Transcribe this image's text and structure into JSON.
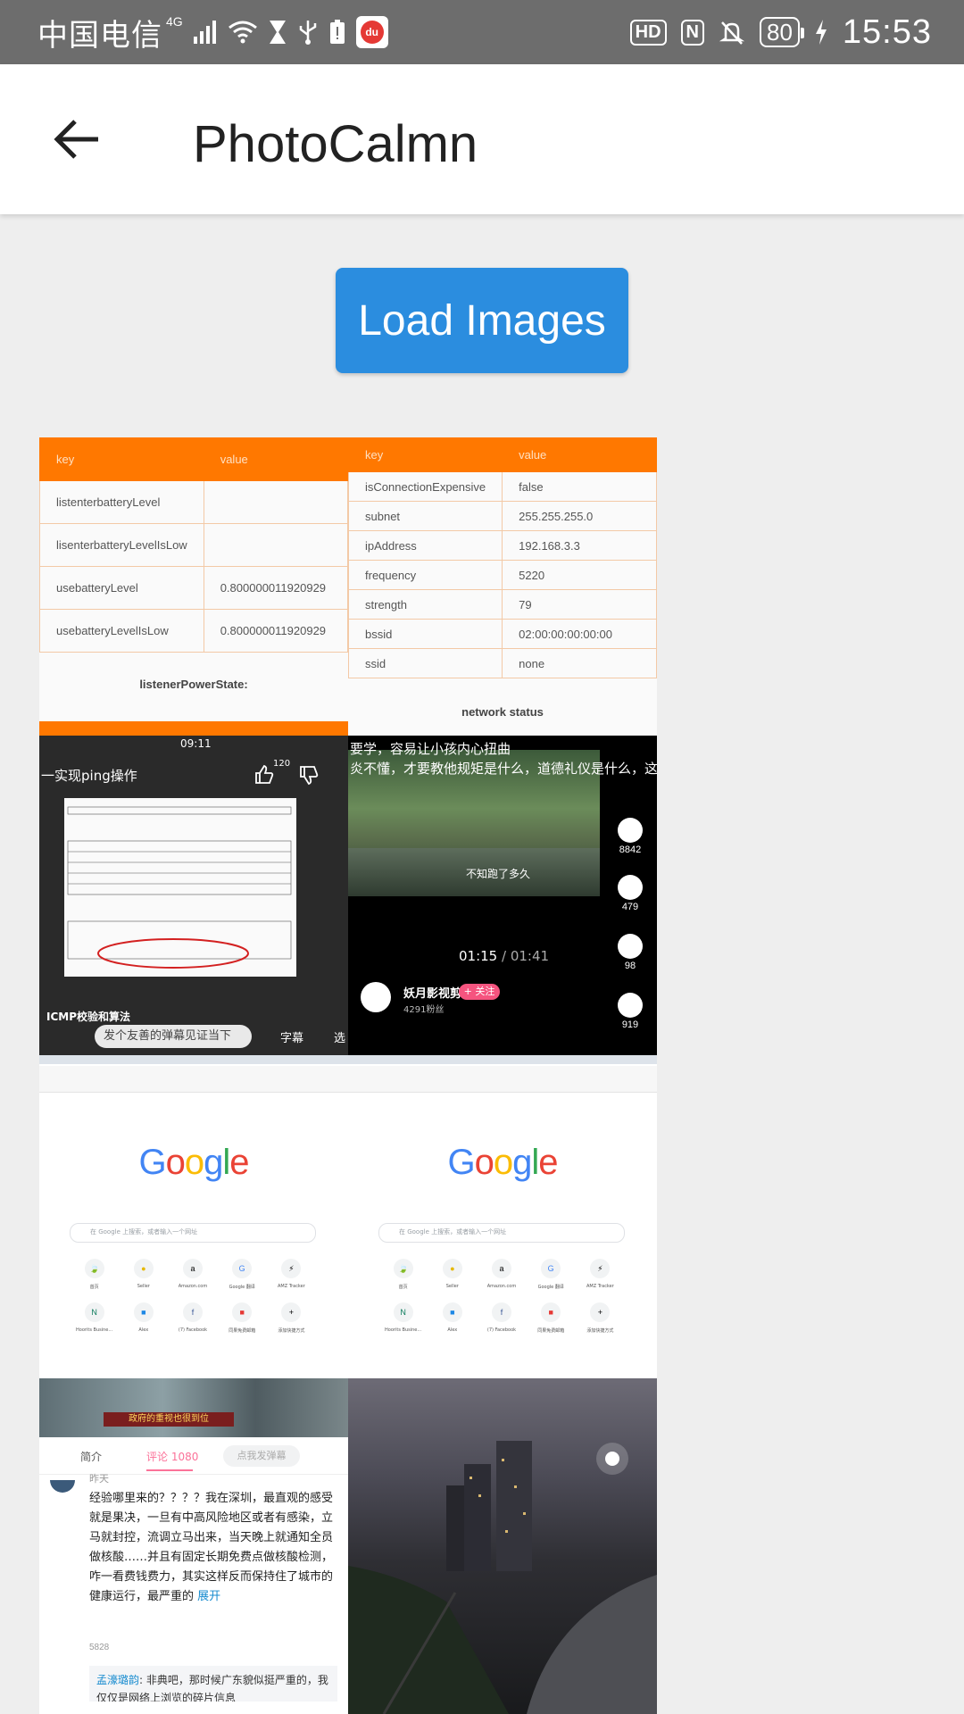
{
  "status_bar": {
    "carrier": "中国电信",
    "network": "4G",
    "hd_label": "HD",
    "nfc_label": "N",
    "battery": "80",
    "time": "15:53",
    "app_icon": "du"
  },
  "app_bar": {
    "title": "PhotoCalmn"
  },
  "load_button": {
    "label": "Load Images"
  },
  "thumbnails": {
    "power_table": {
      "header": [
        "key",
        "value"
      ],
      "rows": [
        [
          "listenterbatteryLevel",
          ""
        ],
        [
          "lisenterbatteryLevelIsLow",
          ""
        ],
        [
          "usebatteryLevel",
          "0.800000011920929"
        ],
        [
          "usebatteryLevelIsLow",
          "0.800000011920929"
        ]
      ],
      "caption": "listenerPowerState:"
    },
    "network_table": {
      "header": [
        "key",
        "value"
      ],
      "rows": [
        [
          "isConnectionExpensive",
          "false"
        ],
        [
          "subnet",
          "255.255.255.0"
        ],
        [
          "ipAddress",
          "192.168.3.3"
        ],
        [
          "frequency",
          "5220"
        ],
        [
          "strength",
          "79"
        ],
        [
          "bssid",
          "02:00:00:00:00:00"
        ],
        [
          "ssid",
          "none"
        ]
      ],
      "caption": "network status"
    },
    "video_ping": {
      "time": "09:11",
      "title": "一实现ping操作",
      "likes": "120",
      "footer_title": "ICMP校验和算法",
      "danmu_placeholder": "发个友善的弹幕见证当下",
      "subtitle_btn": "字幕",
      "select_btn": "选"
    },
    "video_park": {
      "caption_line1": "要学，容易让小孩内心扭曲",
      "caption_line2": "炎不懂，才要教他规矩是什么，道德礼仪是什么，这",
      "subtitle": "不知跑了多久",
      "progress": "01:15",
      "duration": "01:41",
      "likes": "8842",
      "comments": "479",
      "coins": "98",
      "stars": "919",
      "channel": "妖月影视剪辑",
      "follow": "+ 关注",
      "fans": "4291粉丝"
    },
    "google_page": {
      "logo_letters": [
        "G",
        "o",
        "o",
        "g",
        "l",
        "e"
      ],
      "logo_colors": [
        "#4285f4",
        "#ea4335",
        "#fbbc05",
        "#4285f4",
        "#34a853",
        "#ea4335"
      ],
      "search_placeholder": "在 Google 上搜索，或者输入一个网址",
      "shortcuts": [
        "首页",
        "Seller",
        "Amazon.com",
        "Google 翻译",
        "AMZ Tracker",
        "Hoorits Busine...",
        "Alex",
        "(7) Facebook",
        "同果免费邮箱",
        "添加快捷方式"
      ]
    },
    "comment": {
      "banner": "政府的重视也很到位",
      "tab_intro": "简介",
      "tab_comments": "评论 1080",
      "danmu_placeholder": "点我发弹幕",
      "time": "昨天",
      "body": "经验哪里来的？？？？我在深圳，最直观的感受就是果决，一旦有中高风险地区或者有感染，立马就封控，流调立马出来，当天晚上就通知全员做核酸……并且有固定长期免费点做核酸检测，咋一看费钱费力，其实这样反而保持住了城市的健康运行，最严重的",
      "expand": "展开",
      "likes": "5828",
      "reply_name": "孟濠璐韵",
      "reply_text": ": 非典吧，那时候广东貌似挺严重的，我仅仅是网络上浏览的碎片信息"
    }
  }
}
